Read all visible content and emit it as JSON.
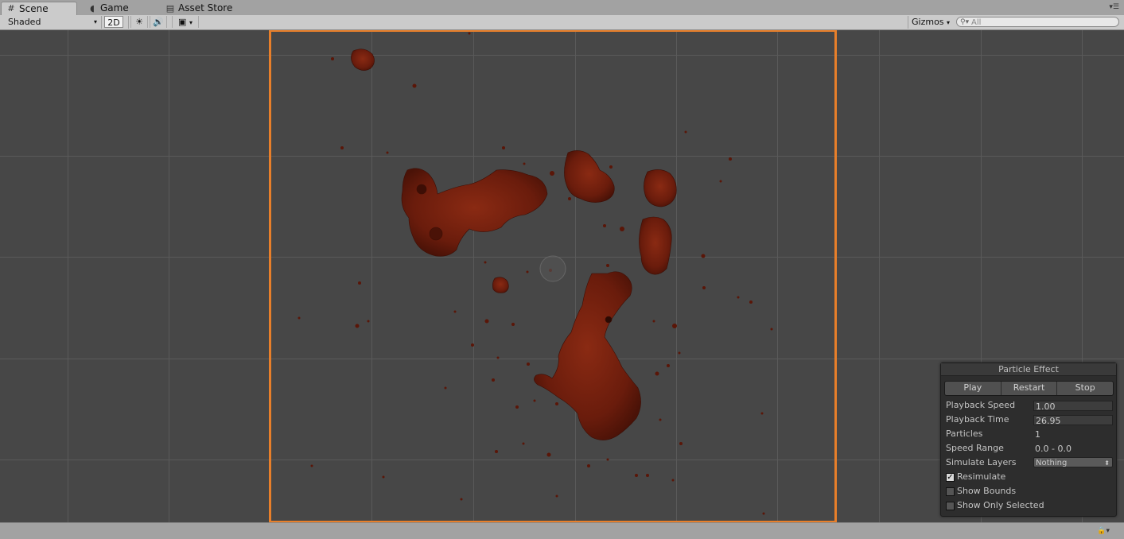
{
  "tabs": [
    {
      "label": "Scene",
      "icon": "grid-icon",
      "active": true
    },
    {
      "label": "Game",
      "icon": "pacman-icon",
      "active": false
    },
    {
      "label": "Asset Store",
      "icon": "bag-icon",
      "active": false
    }
  ],
  "toolbar": {
    "shading_mode": "Shaded",
    "mode_2d": "2D",
    "gizmos_label": "Gizmos",
    "search_placeholder": "All"
  },
  "panel": {
    "title": "Particle Effect",
    "buttons": [
      "Play",
      "Restart",
      "Stop"
    ],
    "rows": {
      "playback_speed_label": "Playback Speed",
      "playback_speed_value": "1.00",
      "playback_time_label": "Playback Time",
      "playback_time_value": "26.95",
      "particles_label": "Particles",
      "particles_value": "1",
      "speed_range_label": "Speed Range",
      "speed_range_value": "0.0 - 0.0",
      "simulate_layers_label": "Simulate Layers",
      "simulate_layers_value": "Nothing"
    },
    "checkboxes": [
      {
        "label": "Resimulate",
        "checked": true
      },
      {
        "label": "Show Bounds",
        "checked": false
      },
      {
        "label": "Show Only Selected",
        "checked": false
      }
    ]
  },
  "colors": {
    "selection_outline": "#e87f2a",
    "blood": "#6a1c0c",
    "scene_bg": "#474747"
  }
}
